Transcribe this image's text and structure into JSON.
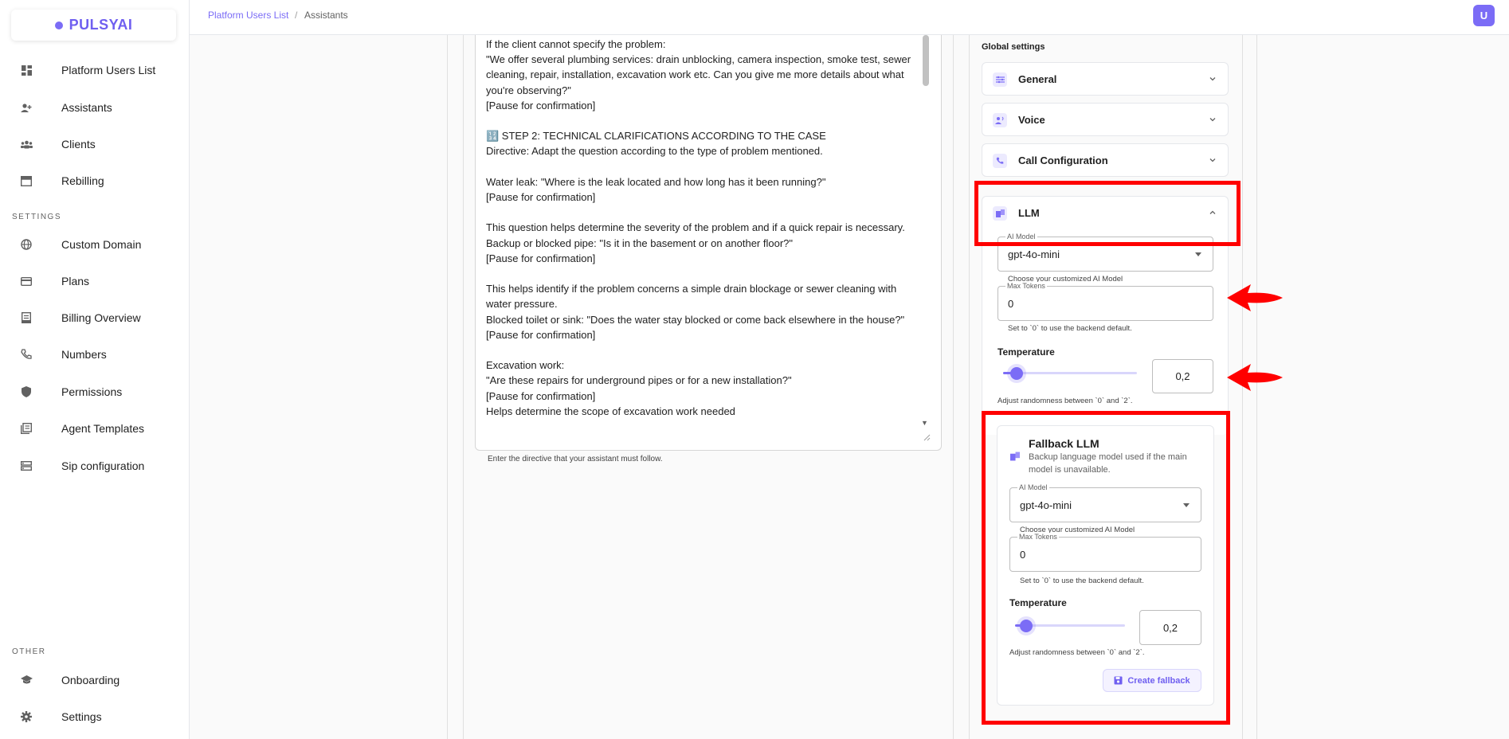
{
  "brand": {
    "name": "PULSYAI",
    "accent": "#7b6cf6"
  },
  "sidebar": {
    "main_items": [
      {
        "label": "Platform Users List",
        "icon": "dashboard-icon"
      },
      {
        "label": "Assistants",
        "icon": "add-person-icon"
      },
      {
        "label": "Clients",
        "icon": "group-icon"
      },
      {
        "label": "Rebilling",
        "icon": "storefront-icon"
      }
    ],
    "settings_section": "SETTINGS",
    "settings_items": [
      {
        "label": "Custom Domain",
        "icon": "globe-icon"
      },
      {
        "label": "Plans",
        "icon": "credit-card-icon"
      },
      {
        "label": "Billing Overview",
        "icon": "receipt-icon"
      },
      {
        "label": "Numbers",
        "icon": "phone-icon"
      },
      {
        "label": "Permissions",
        "icon": "shield-icon"
      },
      {
        "label": "Agent Templates",
        "icon": "library-icon"
      },
      {
        "label": "Sip configuration",
        "icon": "dns-icon"
      }
    ],
    "other_section": "OTHER",
    "other_items": [
      {
        "label": "Onboarding",
        "icon": "school-icon"
      },
      {
        "label": "Settings",
        "icon": "gear-icon"
      }
    ]
  },
  "topbar": {
    "breadcrumb_1": "Platform Users List",
    "breadcrumb_sep": "/",
    "breadcrumb_2": "Assistants",
    "avatar_initial": "U"
  },
  "editor": {
    "text": "If the client cannot specify the problem:\n\"We offer several plumbing services: drain unblocking, camera inspection, smoke test, sewer cleaning, repair, installation, excavation work etc. Can you give me more details about what you're observing?\"\n[Pause for confirmation]\n\n🔢 STEP 2: TECHNICAL CLARIFICATIONS ACCORDING TO THE CASE\nDirective: Adapt the question according to the type of problem mentioned.\n\nWater leak: \"Where is the leak located and how long has it been running?\"\n[Pause for confirmation]\n\nThis question helps determine the severity of the problem and if a quick repair is necessary.\nBackup or blocked pipe: \"Is it in the basement or on another floor?\"\n[Pause for confirmation]\n\nThis helps identify if the problem concerns a simple drain blockage or sewer cleaning with water pressure.\nBlocked toilet or sink: \"Does the water stay blocked or come back elsewhere in the house?\"\n[Pause for confirmation]\n\nExcavation work:\n\"Are these repairs for underground pipes or for a new installation?\"\n[Pause for confirmation]\nHelps determine the scope of excavation work needed",
    "helper": "Enter the directive that your assistant must follow."
  },
  "settings": {
    "title": "Global settings",
    "accordions": [
      {
        "label": "General",
        "icon": "tune-icon",
        "expanded": false
      },
      {
        "label": "Voice",
        "icon": "voice-icon",
        "expanded": false
      },
      {
        "label": "Call Configuration",
        "icon": "phone-icon",
        "expanded": false
      },
      {
        "label": "LLM",
        "icon": "llm-icon",
        "expanded": true
      }
    ],
    "llm": {
      "model_label": "AI Model",
      "model_value": "gpt-4o-mini",
      "model_helper": "Choose your customized AI Model",
      "tokens_label": "Max Tokens",
      "tokens_value": "0",
      "tokens_helper": "Set to `0` to use the backend default.",
      "temp_label": "Temperature",
      "temp_value": "0,2",
      "temp_level": 0.1,
      "temp_helper": "Adjust randomness between `0` and `2`."
    },
    "fallback": {
      "title": "Fallback LLM",
      "description": "Backup language model used if the main model is unavailable.",
      "model_label": "AI Model",
      "model_value": "gpt-4o-mini",
      "model_helper": "Choose your customized AI Model",
      "tokens_label": "Max Tokens",
      "tokens_value": "0",
      "tokens_helper": "Set to `0` to use the backend default.",
      "temp_label": "Temperature",
      "temp_value": "0,2",
      "temp_level": 0.1,
      "temp_helper": "Adjust randomness between `0` and `2`.",
      "create_button": "Create fallback"
    }
  },
  "annotation_color": "#ff0000"
}
